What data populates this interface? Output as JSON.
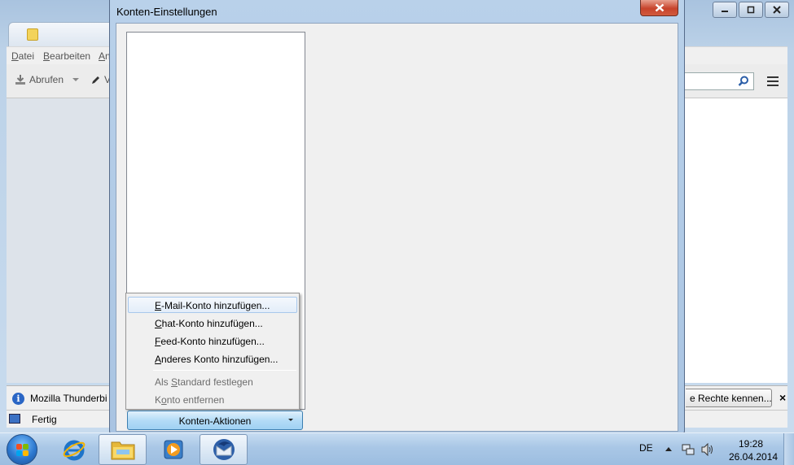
{
  "background_window": {
    "menu": [
      "Datei",
      "Bearbeiten",
      "An"
    ],
    "toolbar": {
      "get_label": "Abrufen",
      "write_label": "V"
    },
    "notification": {
      "text": "Mozilla Thunderbi",
      "rights_button": "e Rechte kennen...",
      "close": "×"
    },
    "status": {
      "text": "Fertig"
    }
  },
  "dialog": {
    "title": "Konten-Einstellungen",
    "actions_button": "Konten-Aktionen",
    "menu": {
      "add_mail": {
        "underline": "E",
        "rest": "-Mail-Konto hinzufügen..."
      },
      "add_chat": {
        "underline": "C",
        "rest": "hat-Konto hinzufügen..."
      },
      "add_feed": {
        "underline": "F",
        "rest": "eed-Konto hinzufügen..."
      },
      "add_other": {
        "underline": "A",
        "rest": "nderes Konto hinzufügen..."
      },
      "set_default": {
        "before": "Als ",
        "underline": "S",
        "rest": "tandard festlegen"
      },
      "remove": {
        "before": "K",
        "underline": "o",
        "rest": "nto entfernen"
      }
    }
  },
  "taskbar": {
    "language": "DE",
    "time": "19:28",
    "date": "26.04.2014"
  },
  "colors": {
    "close_red": "#c7432b",
    "menu_hover_border": "#a8c8ec",
    "button_blue": "#b4dcf7"
  }
}
